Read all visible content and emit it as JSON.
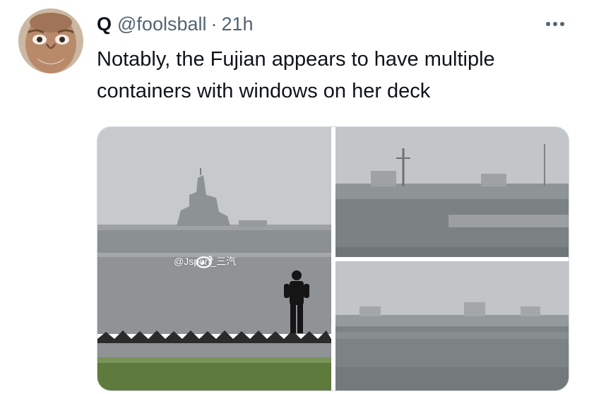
{
  "tweet": {
    "display_name": "Q",
    "handle": "@foolsball",
    "separator": "·",
    "time": "21h",
    "text": "Notably, the Fujian appears to have multiple\ncontainers with windows on her deck",
    "more_icon": "more-horizontal-icon"
  },
  "media": {
    "photos": [
      {
        "description_icon": "photo"
      },
      {
        "description_icon": "photo"
      },
      {
        "description_icon": "photo"
      }
    ],
    "watermark": "@Jsport_三汽",
    "watermark_icon": "weibo-icon"
  },
  "colors": {
    "text": "#0f1419",
    "secondary": "#536471",
    "border": "#cfd9de",
    "sky": "#c4c9cc",
    "water": "#8e9295",
    "grass": "#5e7a3c"
  }
}
